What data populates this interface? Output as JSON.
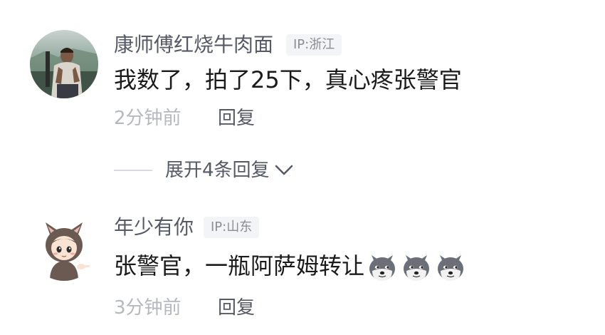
{
  "comments": [
    {
      "username": "康师傅红烧牛肉面",
      "ip": "IP:浙江",
      "text": "我数了，拍了25下，真心疼张警官",
      "time": "2分钟前",
      "reply_label": "回复",
      "avatar": "avatar-photo-person"
    },
    {
      "username": "年少有你",
      "ip": "IP:山东",
      "text": "张警官，一瓶阿萨姆转让",
      "time": "3分钟前",
      "reply_label": "回复",
      "avatar": "avatar-cartoon-cat-hood",
      "emojis": [
        "doge-emoji",
        "doge-emoji",
        "doge-emoji"
      ]
    }
  ],
  "expand": {
    "label": "展开4条回复",
    "icon": "chevron-down-icon"
  },
  "colors": {
    "username": "#555a66",
    "content": "#1a1a1a",
    "meta": "#b5b8bd",
    "badge_bg": "#f3f4f6"
  }
}
